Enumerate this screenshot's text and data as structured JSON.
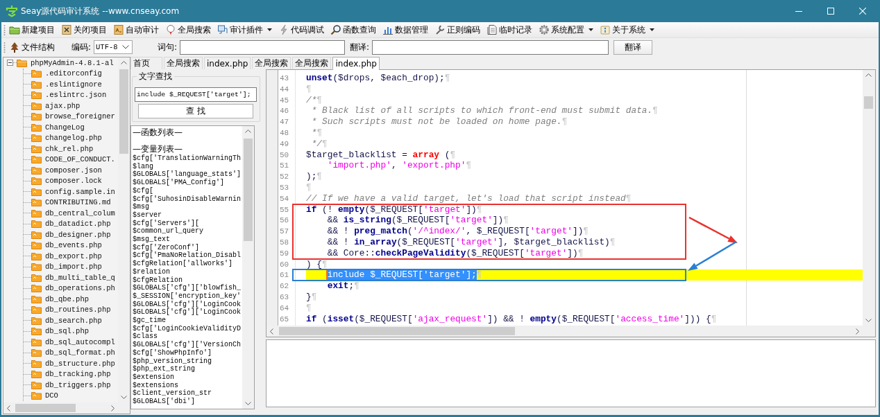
{
  "window": {
    "title": "Seay源代码审计系统 --www.cnseay.com"
  },
  "toolbar": [
    {
      "label": "新建项目",
      "dropdown": false
    },
    {
      "label": "关闭项目",
      "dropdown": false
    },
    {
      "label": "自动审计",
      "dropdown": false
    },
    {
      "label": "全局搜索",
      "dropdown": false
    },
    {
      "label": "审计插件",
      "dropdown": true
    },
    {
      "label": "代码调试",
      "dropdown": false
    },
    {
      "label": "函数查询",
      "dropdown": false
    },
    {
      "label": "数据管理",
      "dropdown": false
    },
    {
      "label": "正则编码",
      "dropdown": false
    },
    {
      "label": "临时记录",
      "dropdown": false
    },
    {
      "label": "系统配置",
      "dropdown": true
    },
    {
      "label": "关于系统",
      "dropdown": true
    }
  ],
  "search_bar": {
    "tree_button": "文件结构",
    "encoding_label": "编码:",
    "encoding": "UTF-8",
    "phrase_label": "词句:",
    "translate_label": "翻译:",
    "translate_button": "翻译"
  },
  "file_tree": {
    "label": "phpMyAdmin-4.8.1-al",
    "expanded": true,
    "children": [
      {
        "label": ".editorconfig"
      },
      {
        "label": ".eslintignore"
      },
      {
        "label": ".eslintrc.json"
      },
      {
        "label": "ajax.php"
      },
      {
        "label": "browse_foreigner"
      },
      {
        "label": "ChangeLog"
      },
      {
        "label": "changelog.php"
      },
      {
        "label": "chk_rel.php"
      },
      {
        "label": "CODE_OF_CONDUCT."
      },
      {
        "label": "composer.json"
      },
      {
        "label": "composer.lock"
      },
      {
        "label": "config.sample.in"
      },
      {
        "label": "CONTRIBUTING.md"
      },
      {
        "label": "db_central_colum"
      },
      {
        "label": "db_datadict.php"
      },
      {
        "label": "db_designer.php"
      },
      {
        "label": "db_events.php"
      },
      {
        "label": "db_export.php"
      },
      {
        "label": "db_import.php"
      },
      {
        "label": "db_multi_table_q"
      },
      {
        "label": "db_operations.ph"
      },
      {
        "label": "db_qbe.php"
      },
      {
        "label": "db_routines.php"
      },
      {
        "label": "db_search.php"
      },
      {
        "label": "db_sql.php"
      },
      {
        "label": "db_sql_autocompl"
      },
      {
        "label": "db_sql_format.ph"
      },
      {
        "label": "db_structure.php"
      },
      {
        "label": "db_tracking.php"
      },
      {
        "label": "db_triggers.php"
      },
      {
        "label": "DCO"
      }
    ]
  },
  "tabs": [
    {
      "label": "首页",
      "selected": false
    },
    {
      "label": "全局搜索",
      "selected": false
    },
    {
      "label": "index.php",
      "selected": false
    },
    {
      "label": "全局搜索",
      "selected": false
    },
    {
      "label": "全局搜索",
      "selected": false
    },
    {
      "label": "index.php",
      "selected": true
    }
  ],
  "text_search": {
    "title": "文字查找",
    "value": "include $_REQUEST['target'];",
    "button": "查 找"
  },
  "symbol_list": {
    "sections": [
      {
        "header": "—函数列表—"
      },
      {
        "header": "—变量列表—",
        "items": [
          "$cfg['TranslationWarningTh",
          "$lang",
          "$GLOBALS['language_stats']",
          "$GLOBALS['PMA_Config']",
          "$cfg[",
          "$cfg['SuhosinDisableWarnin",
          "$msg",
          "$server",
          "$cfg['Servers'][",
          "$common_url_query",
          "$msg_text",
          "$cfg['ZeroConf']",
          "$cfg['PmaNoRelation_Disabl",
          "$cfgRelation['allworks']",
          "$relation",
          "$cfgRelation",
          "$GLOBALS['cfg']['blowfish_",
          "$_SESSION['encryption_key'",
          "$GLOBALS['cfg']['LoginCook",
          "$GLOBALS['cfg']['LoginCook",
          "$gc_time",
          "$cfg['LoginCookieValidityD",
          "$class",
          "$GLOBALS['cfg']['VersionCh",
          "$cfg['ShowPhpInfo']",
          "$php_version_string",
          "$php_ext_string",
          "$extension",
          "$extensions",
          "$client_version_str",
          "$GLOBALS['dbi']"
        ]
      }
    ]
  },
  "editor": {
    "blocks": [
      {
        "lines": [
          {
            "number": "43",
            "current": false,
            "tokens": [
              {
                "kind": "keyword",
                "text": "unset"
              },
              {
                "kind": "plain",
                "text": "($drops, $each_drop);"
              },
              {
                "kind": "eol",
                "text": "¶"
              }
            ]
          },
          {
            "number": "44",
            "current": false,
            "tokens": [
              {
                "kind": "eol",
                "text": "¶"
              }
            ]
          },
          {
            "number": "45",
            "current": false,
            "tokens": [
              {
                "kind": "comment",
                "text": "/*"
              },
              {
                "kind": "eol",
                "text": "¶"
              }
            ]
          },
          {
            "number": "46",
            "current": false,
            "tokens": [
              {
                "kind": "comment",
                "text": " * Black list of all scripts to which front-end must submit data."
              },
              {
                "kind": "eol",
                "text": "¶"
              }
            ]
          },
          {
            "number": "47",
            "current": false,
            "tokens": [
              {
                "kind": "comment",
                "text": " * Such scripts must not be loaded on home page."
              },
              {
                "kind": "eol",
                "text": "¶"
              }
            ]
          },
          {
            "number": "48",
            "current": false,
            "tokens": [
              {
                "kind": "comment",
                "text": " *"
              },
              {
                "kind": "eol",
                "text": "¶"
              }
            ]
          },
          {
            "number": "49",
            "current": false,
            "tokens": [
              {
                "kind": "comment",
                "text": " */"
              },
              {
                "kind": "eol",
                "text": "¶"
              }
            ]
          },
          {
            "number": "50",
            "current": false,
            "tokens": [
              {
                "kind": "plain",
                "text": "$target_blacklist = "
              },
              {
                "kind": "type",
                "text": "array"
              },
              {
                "kind": "plain",
                "text": " ("
              },
              {
                "kind": "eol",
                "text": "¶"
              }
            ]
          },
          {
            "number": "51",
            "current": false,
            "tokens": [
              {
                "kind": "string",
                "text": "    'import.php'"
              },
              {
                "kind": "plain",
                "text": ", "
              },
              {
                "kind": "string",
                "text": "'export.php'"
              },
              {
                "kind": "eol",
                "text": "¶"
              }
            ]
          },
          {
            "number": "52",
            "current": false,
            "tokens": [
              {
                "kind": "plain",
                "text": ");"
              },
              {
                "kind": "eol",
                "text": "¶"
              }
            ]
          },
          {
            "number": "53",
            "current": false,
            "tokens": [
              {
                "kind": "eol",
                "text": "¶"
              }
            ]
          },
          {
            "number": "54",
            "current": false,
            "tokens": [
              {
                "kind": "comment",
                "text": "// If we have a valid target, let's load that script instead"
              },
              {
                "kind": "eol",
                "text": "¶"
              }
            ]
          }
        ]
      },
      {
        "frame": {
          "color": "#e8322f",
          "arrow": {
            "kind": "out"
          }
        },
        "lines": [
          {
            "number": "55",
            "current": false,
            "tokens": [
              {
                "kind": "keyword",
                "text": "if"
              },
              {
                "kind": "plain",
                "text": " (! "
              },
              {
                "kind": "keyword",
                "text": "empty"
              },
              {
                "kind": "plain",
                "text": "($_REQUEST["
              },
              {
                "kind": "string",
                "text": "'target'"
              },
              {
                "kind": "plain",
                "text": "])"
              },
              {
                "kind": "eol",
                "text": "¶"
              }
            ]
          },
          {
            "number": "56",
            "current": false,
            "tokens": [
              {
                "kind": "plain",
                "text": "    && "
              },
              {
                "kind": "keyword",
                "text": "is_string"
              },
              {
                "kind": "plain",
                "text": "($_REQUEST["
              },
              {
                "kind": "string",
                "text": "'target'"
              },
              {
                "kind": "plain",
                "text": "])"
              },
              {
                "kind": "eol",
                "text": "¶"
              }
            ]
          },
          {
            "number": "57",
            "current": false,
            "tokens": [
              {
                "kind": "plain",
                "text": "    && ! "
              },
              {
                "kind": "keyword",
                "text": "preg_match"
              },
              {
                "kind": "plain",
                "text": "("
              },
              {
                "kind": "string",
                "text": "'/^index/'"
              },
              {
                "kind": "plain",
                "text": ", $_REQUEST["
              },
              {
                "kind": "string",
                "text": "'target'"
              },
              {
                "kind": "plain",
                "text": "])"
              },
              {
                "kind": "eol",
                "text": "¶"
              }
            ]
          },
          {
            "number": "58",
            "current": false,
            "tokens": [
              {
                "kind": "plain",
                "text": "    && ! "
              },
              {
                "kind": "keyword",
                "text": "in_array"
              },
              {
                "kind": "plain",
                "text": "($_REQUEST["
              },
              {
                "kind": "string",
                "text": "'target'"
              },
              {
                "kind": "plain",
                "text": "], $target_blacklist)"
              },
              {
                "kind": "eol",
                "text": "¶"
              }
            ]
          },
          {
            "number": "59",
            "current": false,
            "tokens": [
              {
                "kind": "plain",
                "text": "    && Core::"
              },
              {
                "kind": "keyword",
                "text": "checkPageValidity"
              },
              {
                "kind": "plain",
                "text": "($_REQUEST["
              },
              {
                "kind": "string",
                "text": "'target'"
              },
              {
                "kind": "plain",
                "text": "])"
              },
              {
                "kind": "eol",
                "text": "¶"
              }
            ]
          }
        ]
      },
      {
        "lines": [
          {
            "number": "60",
            "current": false,
            "tokens": [
              {
                "kind": "plain",
                "text": ") {"
              },
              {
                "kind": "eol",
                "text": "¶"
              }
            ]
          }
        ]
      },
      {
        "frame": {
          "color": "#2a7fd4",
          "arrow": {
            "kind": "in"
          }
        },
        "lines": [
          {
            "number": "61",
            "current": true,
            "tokens": [
              {
                "kind": "selection",
                "text": "    include $_REQUEST['target'];"
              },
              {
                "kind": "eol",
                "text": "¶"
              }
            ]
          }
        ]
      },
      {
        "lines": [
          {
            "number": "62",
            "current": false,
            "tokens": [
              {
                "kind": "keyword",
                "text": "    exit"
              },
              {
                "kind": "plain",
                "text": ";"
              },
              {
                "kind": "eol",
                "text": "¶"
              }
            ]
          },
          {
            "number": "63",
            "current": false,
            "tokens": [
              {
                "kind": "plain",
                "text": "}"
              },
              {
                "kind": "eol",
                "text": "¶"
              }
            ]
          },
          {
            "number": "64",
            "current": false,
            "tokens": [
              {
                "kind": "eol",
                "text": "¶"
              }
            ]
          },
          {
            "number": "65",
            "current": false,
            "tokens": [
              {
                "kind": "keyword",
                "text": "if"
              },
              {
                "kind": "plain",
                "text": " ("
              },
              {
                "kind": "keyword",
                "text": "isset"
              },
              {
                "kind": "plain",
                "text": "($_REQUEST["
              },
              {
                "kind": "string",
                "text": "'ajax_request'"
              },
              {
                "kind": "plain",
                "text": "]) && ! "
              },
              {
                "kind": "keyword",
                "text": "empty"
              },
              {
                "kind": "plain",
                "text": "($_REQUEST["
              },
              {
                "kind": "string",
                "text": "'access_time'"
              },
              {
                "kind": "plain",
                "text": "])) {"
              },
              {
                "kind": "eol",
                "text": "¶"
              }
            ]
          }
        ]
      }
    ]
  }
}
